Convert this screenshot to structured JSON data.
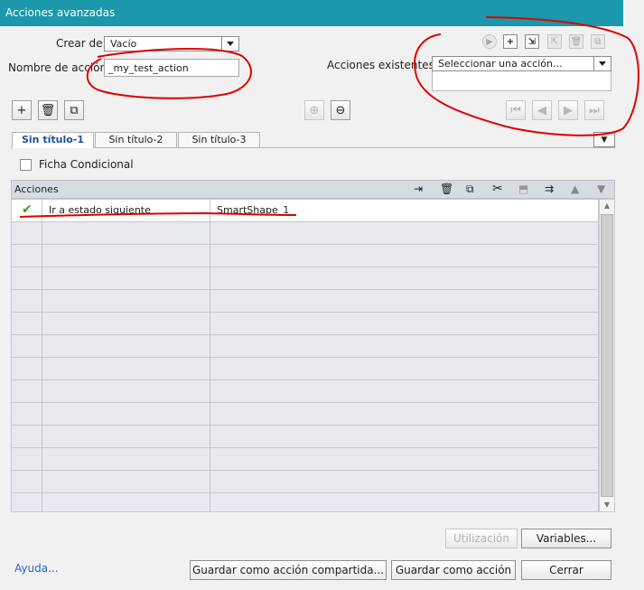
{
  "window": {
    "title": "Acciones avanzadas"
  },
  "create_from": {
    "label": "Crear de:",
    "value": "Vacío"
  },
  "action_name": {
    "label": "Nombre de acción:",
    "value": "_my_test_action"
  },
  "existing": {
    "label": "Acciones existentes:",
    "value": "Seleccionar una acción..."
  },
  "tabs": [
    {
      "label": "Sin título-1",
      "active": true
    },
    {
      "label": "Sin título-2",
      "active": false
    },
    {
      "label": "Sin título-3",
      "active": false
    }
  ],
  "conditional": {
    "label": "Ficha Condicional",
    "checked": false
  },
  "actions_header": {
    "label": "Acciones"
  },
  "actions_rows": [
    {
      "status_icon": "checkmark-icon",
      "action": "Ir a estado siguiente",
      "target": "SmartShape_1"
    }
  ],
  "buttons": {
    "usage": "Utilización",
    "variables": "Variables...",
    "save_shared": "Guardar como acción compartida...",
    "save_action": "Guardar como acción",
    "close": "Cerrar"
  },
  "help_link": "Ayuda...",
  "colors": {
    "titlebar": "#1b98ab",
    "annotation": "#e00000",
    "active_tab": "#1f4fa3",
    "link": "#2b66c4"
  }
}
